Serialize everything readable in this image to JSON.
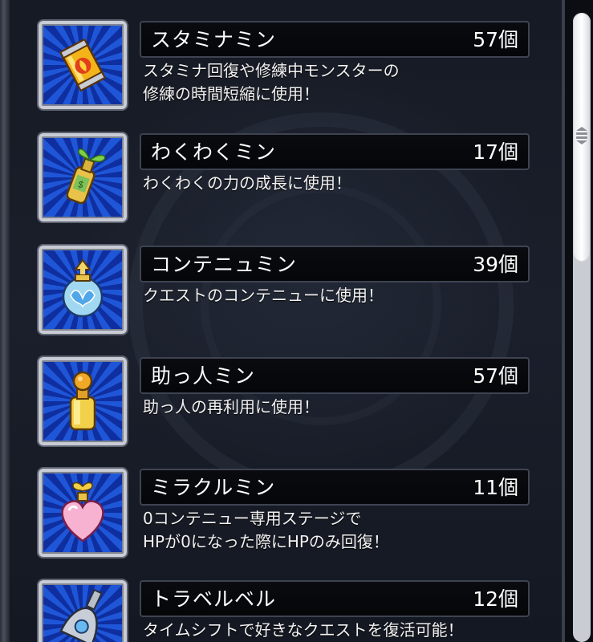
{
  "items": [
    {
      "name": "スタミナミン",
      "count": "57個",
      "desc_line1": "スタミナ回復や修練中モンスターの",
      "desc_line2": "修練の時間短縮に使用！",
      "icon": "stamina-can-icon"
    },
    {
      "name": "わくわくミン",
      "count": "17個",
      "desc_line1": "わくわくの力の成長に使用！",
      "desc_line2": "",
      "icon": "sprout-bottle-icon"
    },
    {
      "name": "コンテニュミン",
      "count": "39個",
      "desc_line1": "クエストのコンテニューに使用！",
      "desc_line2": "",
      "icon": "winged-jar-icon"
    },
    {
      "name": "助っ人ミン",
      "count": "57個",
      "desc_line1": "助っ人の再利用に使用！",
      "desc_line2": "",
      "icon": "helper-bottle-icon"
    },
    {
      "name": "ミラクルミン",
      "count": "11個",
      "desc_line1": "0コンテニュー専用ステージで",
      "desc_line2": "HPが0になった際にHPのみ回復！",
      "icon": "heart-bottle-icon"
    },
    {
      "name": "トラベルベル",
      "count": "12個",
      "desc_line1": "タイムシフトで好きなクエストを復活可能！",
      "desc_line2": "",
      "icon": "travel-bell-icon"
    }
  ],
  "colors": {
    "tile_blue": "#1f56d8",
    "tile_dark_blue": "#0f2fa0",
    "frame_silver": "#c9ccd4",
    "bar_bg": "#050608"
  }
}
